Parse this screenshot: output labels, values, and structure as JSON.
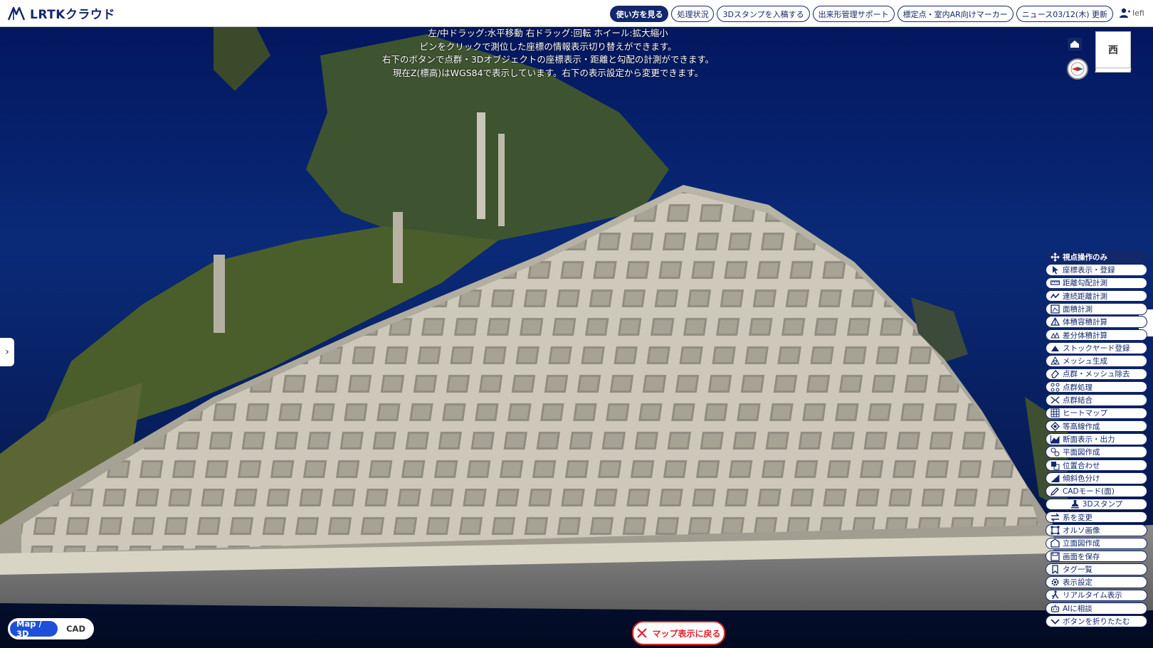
{
  "app": {
    "logo_text": "LRTKクラウド"
  },
  "nav": {
    "items": [
      {
        "label": "使い方を見る",
        "primary": true
      },
      {
        "label": "処理状況",
        "primary": false
      },
      {
        "label": "3Dスタンプを入稿する",
        "primary": false
      },
      {
        "label": "出来形管理サポート",
        "primary": false
      },
      {
        "label": "標定点・室内AR向けマーカー",
        "primary": false
      },
      {
        "label": "ニュース03/12(木) 更新",
        "primary": false
      }
    ],
    "user_name": "lefi"
  },
  "instructions": [
    "左/中ドラッグ:水平移動 右ドラッグ:回転 ホイール:拡大縮小",
    "ピンをクリックで測位した座標の情報表示切り替えができます。",
    "右下のボタンで点群・3Dオブジェクトの座標表示・距離と勾配の計測ができます。",
    "現在Z(標高)はWGS84で表示しています。右下の表示設定から変更できます。"
  ],
  "cube_face": "西",
  "tools": [
    {
      "label": "視点操作のみ",
      "icon": "move-icon",
      "active": true
    },
    {
      "label": "座標表示・登録",
      "icon": "cursor-icon",
      "active": false
    },
    {
      "label": "距離勾配計測",
      "icon": "ruler-icon",
      "active": false
    },
    {
      "label": "連続距離計測",
      "icon": "polyline-icon",
      "active": false
    },
    {
      "label": "面積計測",
      "icon": "area-icon",
      "active": false
    },
    {
      "label": "体積容積計算",
      "icon": "volume-icon",
      "active": false
    },
    {
      "label": "差分体積計算",
      "icon": "diff-volume-icon",
      "active": false
    },
    {
      "label": "ストックヤード登録",
      "icon": "stockyard-icon",
      "active": false
    },
    {
      "label": "メッシュ生成",
      "icon": "mesh-icon",
      "active": false
    },
    {
      "label": "点群・メッシュ除去",
      "icon": "eraser-icon",
      "active": false
    },
    {
      "label": "点群処理",
      "icon": "points-icon",
      "active": false
    },
    {
      "label": "点群結合",
      "icon": "merge-icon",
      "active": false
    },
    {
      "label": "ヒートマップ",
      "icon": "grid-icon",
      "active": false
    },
    {
      "label": "等高線作成",
      "icon": "contour-icon",
      "active": false
    },
    {
      "label": "断面表示・出力",
      "icon": "section-icon",
      "active": false
    },
    {
      "label": "平面図作成",
      "icon": "plan-icon",
      "active": false
    },
    {
      "label": "位置合わせ",
      "icon": "align-icon",
      "active": false
    },
    {
      "label": "傾斜色分け",
      "icon": "slope-icon",
      "active": false
    },
    {
      "label": "CADモード(面)",
      "icon": "pencil-icon",
      "active": false
    },
    {
      "label": "3Dスタンプ",
      "icon": "stamp-icon",
      "active": false
    },
    {
      "label": "系を変更",
      "icon": "transform-icon",
      "active": false
    },
    {
      "label": "オルソ画像",
      "icon": "ortho-icon",
      "active": false
    },
    {
      "label": "立面図作成",
      "icon": "elevation-icon",
      "active": false
    },
    {
      "label": "画面を保存",
      "icon": "save-screen-icon",
      "active": false
    },
    {
      "label": "タグ一覧",
      "icon": "bookmark-icon",
      "active": false
    },
    {
      "label": "表示設定",
      "icon": "gear-icon",
      "active": false
    },
    {
      "label": "リアルタイム表示",
      "icon": "walker-icon",
      "active": false
    },
    {
      "label": "AIに相談",
      "icon": "robot-icon",
      "active": false
    },
    {
      "label": "ボタンを折りたたむ",
      "icon": "chevron-down-icon",
      "active": false
    }
  ],
  "mode": {
    "map3d": "Map / 3D",
    "cad": "CAD",
    "active": "map3d"
  },
  "back_to_map": "マップ表示に戻る",
  "colors": {
    "brand": "#13286b",
    "accent_blue": "#1e4fd8",
    "alert_red": "#e0232d"
  }
}
